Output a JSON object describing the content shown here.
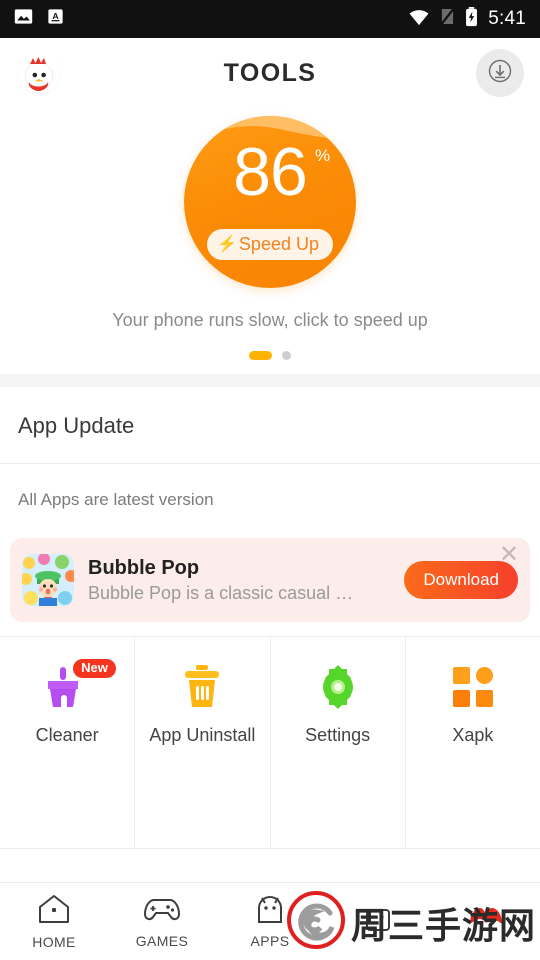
{
  "statusbar": {
    "icons": [
      "image-icon",
      "a-text-icon",
      "wifi-icon",
      "signal-off-icon",
      "battery-charging-icon"
    ],
    "time": "5:41"
  },
  "header": {
    "logo": "chicken-logo",
    "title": "TOOLS",
    "download_icon": "download-circle-icon"
  },
  "gauge": {
    "value": "86",
    "percent": "%",
    "button_label": "Speed Up",
    "bolt_icon": "bolt-icon",
    "caption": "Your phone runs slow, click to speed up",
    "dots": [
      "active",
      "inactive"
    ],
    "accent_color": "#f98302",
    "pill_text_color": "#f5821f"
  },
  "app_update": {
    "title": "App Update",
    "status": "All Apps are latest version"
  },
  "ad": {
    "icon": "bubble-pop-app-icon",
    "title": "Bubble Pop",
    "description": "Bubble Pop is a classic casual bubble pu...",
    "download_label": "Download",
    "close_icon": "close-icon",
    "background_color": "#fcecea",
    "button_color": "#f5402c"
  },
  "tools": [
    {
      "label": "Cleaner",
      "icon": "broom-icon",
      "badge": "New",
      "color": "#b44ef0"
    },
    {
      "label": "App Uninstall",
      "icon": "trash-icon",
      "badge": "",
      "color": "#ffb511"
    },
    {
      "label": "Settings",
      "icon": "gear-icon",
      "badge": "",
      "color": "#56d62a"
    },
    {
      "label": "Xapk",
      "icon": "grid-squares-icon",
      "badge": "",
      "color": "#ff8c1a"
    }
  ],
  "bottom_nav": [
    {
      "label": "HOME",
      "icon": "home-icon"
    },
    {
      "label": "GAMES",
      "icon": "gamepad-icon"
    },
    {
      "label": "APPS",
      "icon": "android-icon"
    },
    {
      "label": "",
      "icon": "robot-box-icon"
    },
    {
      "label": "",
      "icon": "red-mustache-icon"
    }
  ],
  "watermark": {
    "text": "周三手游网",
    "icon": "spiral-logo-icon",
    "color": "#e02020"
  }
}
